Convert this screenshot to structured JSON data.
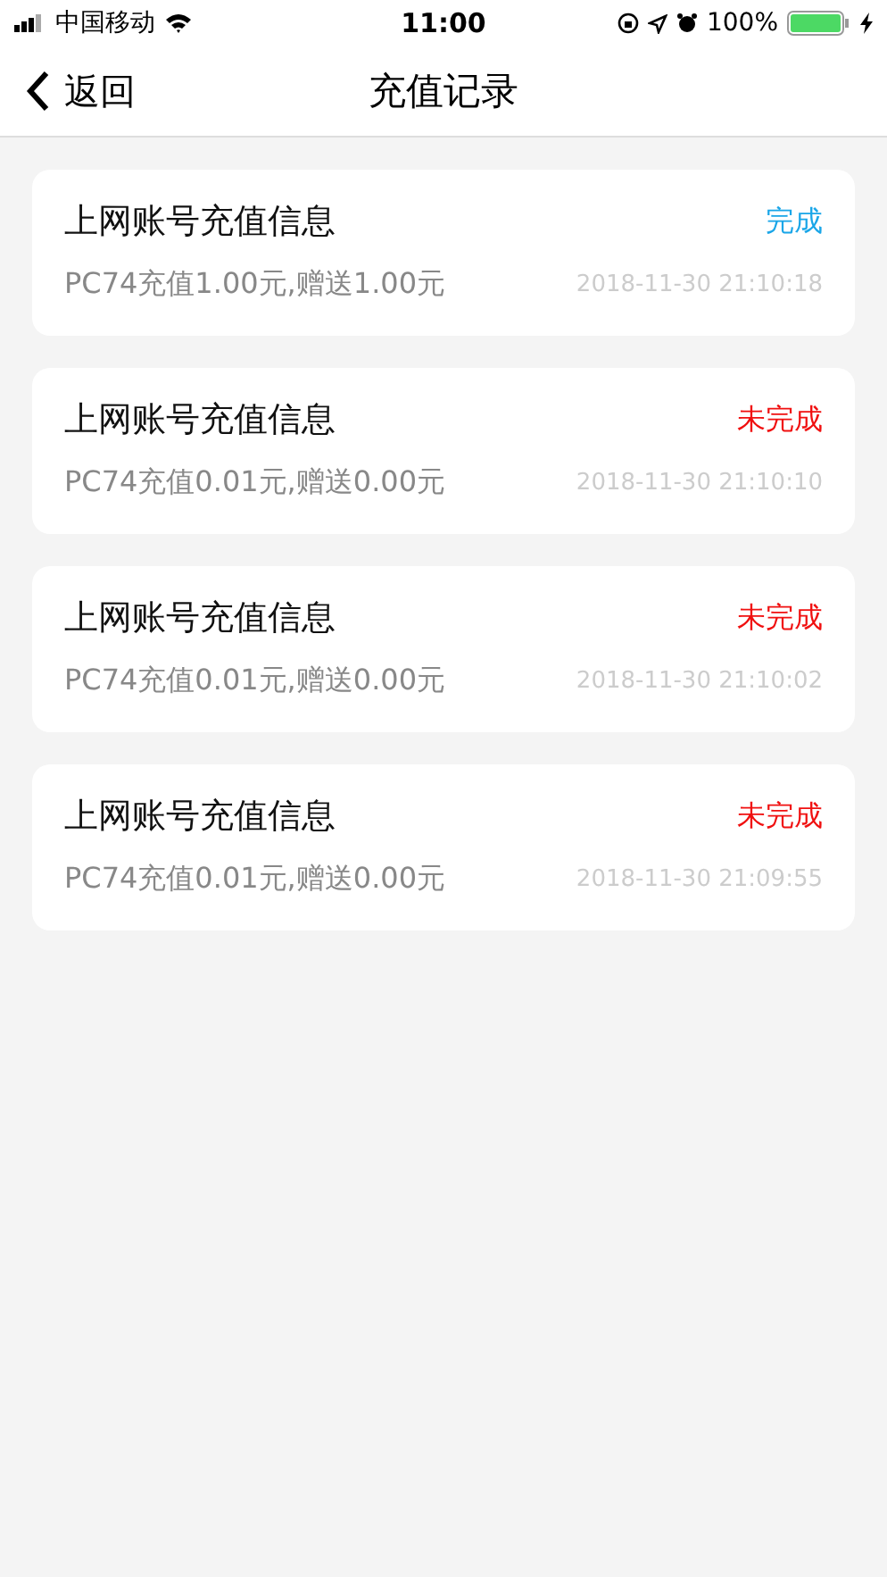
{
  "status_bar": {
    "carrier": "中国移动",
    "time": "11:00",
    "battery": "100%"
  },
  "nav": {
    "back": "返回",
    "title": "充值记录"
  },
  "records": [
    {
      "title": "上网账号充值信息",
      "status": "完成",
      "completed": true,
      "detail": "PC74充值1.00元,赠送1.00元",
      "time": "2018-11-30 21:10:18"
    },
    {
      "title": "上网账号充值信息",
      "status": "未完成",
      "completed": false,
      "detail": "PC74充值0.01元,赠送0.00元",
      "time": "2018-11-30 21:10:10"
    },
    {
      "title": "上网账号充值信息",
      "status": "未完成",
      "completed": false,
      "detail": "PC74充值0.01元,赠送0.00元",
      "time": "2018-11-30 21:10:02"
    },
    {
      "title": "上网账号充值信息",
      "status": "未完成",
      "completed": false,
      "detail": "PC74充值0.01元,赠送0.00元",
      "time": "2018-11-30 21:09:55"
    }
  ]
}
